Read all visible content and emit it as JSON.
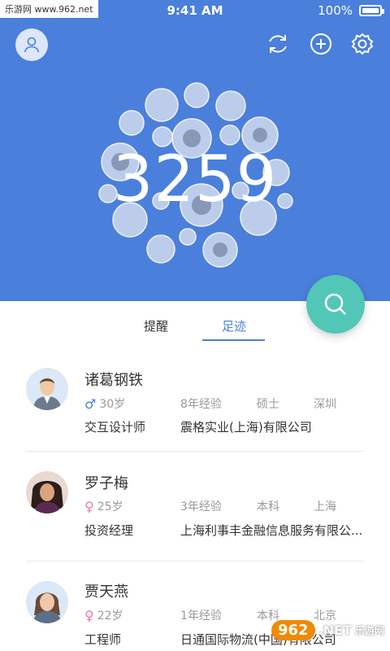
{
  "status_bar": {
    "brand": "乐游网 www.962.net",
    "time": "9:41 AM",
    "battery_text": "100%",
    "battery_level": 1.0
  },
  "header": {
    "count": "3259",
    "colors": {
      "primary": "#4a7fdc",
      "fab": "#52c7b8"
    },
    "icons": [
      "user-icon",
      "refresh-icon",
      "add-icon",
      "settings-icon",
      "search-icon"
    ]
  },
  "tabs": [
    {
      "label": "提醒",
      "active": false
    },
    {
      "label": "足迹",
      "active": true
    }
  ],
  "people": [
    {
      "name": "诸葛钢铁",
      "gender": "♂",
      "age": "30岁",
      "experience": "8年经验",
      "education": "硕士",
      "city": "深圳",
      "title": "交互设计师",
      "company": "震格实业(上海)有限公司"
    },
    {
      "name": "罗子梅",
      "gender": "♀",
      "age": "25岁",
      "experience": "3年经验",
      "education": "本科",
      "city": "上海",
      "title": "投资经理",
      "company": "上海利事丰金融信息服务有限公..."
    },
    {
      "name": "贾天燕",
      "gender": "♀",
      "age": "22岁",
      "experience": "1年经验",
      "education": "本科",
      "city": "北京",
      "title": "工程师",
      "company": "日通国际物流(中国)有限公司"
    }
  ],
  "watermark": {
    "badge": "962",
    "text": ".NET",
    "sub": "乐游网"
  }
}
